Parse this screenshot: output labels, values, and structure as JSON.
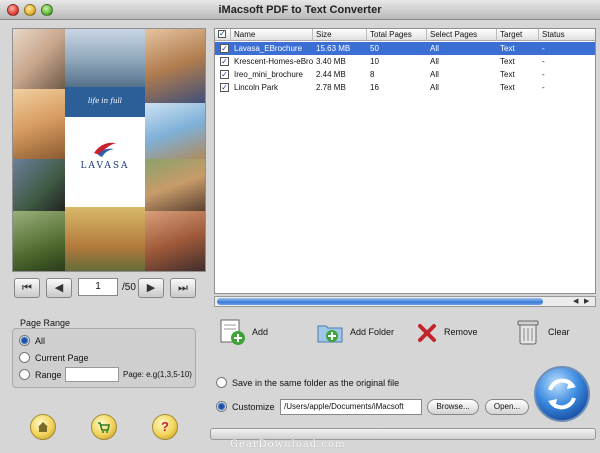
{
  "window": {
    "title": "iMacsoft PDF to Text Converter"
  },
  "preview": {
    "brochure_tagline": "life in full",
    "brochure_logo": "LAVASA",
    "page_current": "1",
    "page_total": "/50"
  },
  "page_range": {
    "label": "Page Range",
    "all_label": "All",
    "current_label": "Current Page",
    "range_label": "Range",
    "range_value": "",
    "hint": "Page: e.g(1,3,5-10)",
    "selected": "All"
  },
  "table": {
    "columns": [
      "Name",
      "Size",
      "Total Pages",
      "Select Pages",
      "Target",
      "Status"
    ],
    "rows": [
      {
        "name": "Lavasa_EBrochure",
        "size": "15.63 MB",
        "pages": "50",
        "select": "All",
        "target": "Text",
        "status": "-",
        "selected": true
      },
      {
        "name": "Krescent-Homes-eBroc",
        "size": "3.40 MB",
        "pages": "10",
        "select": "All",
        "target": "Text",
        "status": "-",
        "selected": false
      },
      {
        "name": "Ireo_mini_brochure",
        "size": "2.44 MB",
        "pages": "8",
        "select": "All",
        "target": "Text",
        "status": "-",
        "selected": false
      },
      {
        "name": "Lincoln Park",
        "size": "2.78 MB",
        "pages": "16",
        "select": "All",
        "target": "Text",
        "status": "-",
        "selected": false
      }
    ]
  },
  "actions": {
    "add": "Add",
    "add_folder": "Add Folder",
    "remove": "Remove",
    "clear": "Clear"
  },
  "output": {
    "same_folder_label": "Save in the same folder as the original file",
    "customize_label": "Customize",
    "path": "/Users/apple/Documents/iMacsoft",
    "browse": "Browse...",
    "open": "Open...",
    "selected": "Customize"
  },
  "watermark": "GearDownload.com",
  "colors": {
    "selection": "#3b6fd4",
    "accent": "#3b8ae0",
    "remove": "#c0262c"
  }
}
